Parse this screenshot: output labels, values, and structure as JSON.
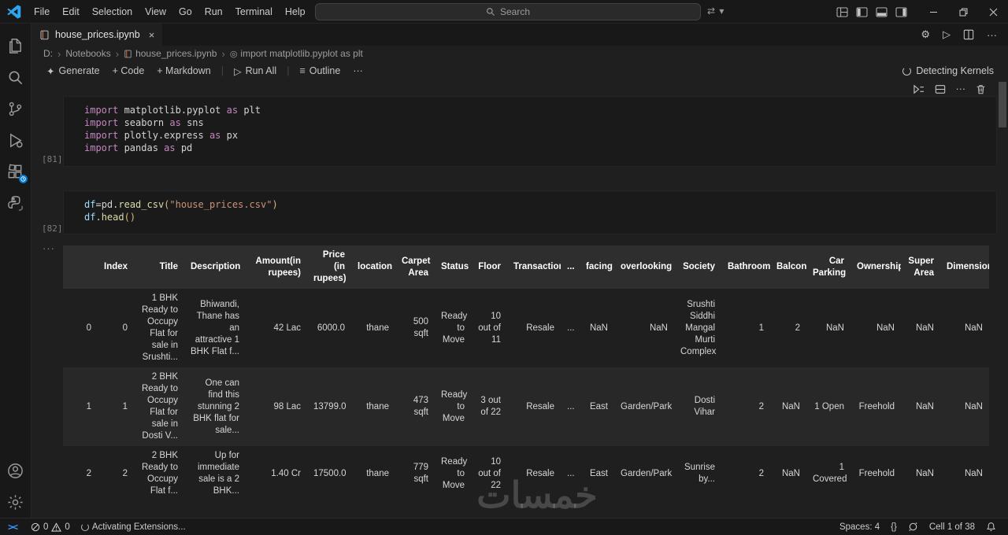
{
  "colors": {
    "accent": "#0078d4",
    "keyword": "#c586c0",
    "string": "#ce9178",
    "function": "#dcdcaa",
    "variable": "#9cdcfe",
    "editor_bg": "#1f1f1f",
    "chrome_bg": "#181818"
  },
  "title_bar": {
    "menus": [
      "File",
      "Edit",
      "Selection",
      "View",
      "Go",
      "Run",
      "Terminal",
      "Help"
    ],
    "search_placeholder": "Search"
  },
  "tab_bar": {
    "tab_label": "house_prices.ipynb",
    "close_glyph": "×"
  },
  "breadcrumb": {
    "items": [
      "D:",
      "Notebooks",
      "house_prices.ipynb",
      "import matplotlib.pyplot as plt"
    ]
  },
  "notebook_toolbar": {
    "generate": "Generate",
    "add_code": "+ Code",
    "add_markdown": "+ Markdown",
    "run_all": "Run All",
    "outline": "Outline",
    "more": "···",
    "kernel_status": "Detecting Kernels"
  },
  "cells": [
    {
      "exec": "[81]",
      "lines": [
        [
          {
            "t": "import",
            "c": "kw"
          },
          {
            "t": " matplotlib.pyplot ",
            "c": "id"
          },
          {
            "t": "as",
            "c": "kw"
          },
          {
            "t": " plt",
            "c": "id"
          }
        ],
        [
          {
            "t": "import",
            "c": "kw"
          },
          {
            "t": " seaborn ",
            "c": "id"
          },
          {
            "t": "as",
            "c": "kw"
          },
          {
            "t": " sns",
            "c": "id"
          }
        ],
        [
          {
            "t": "import",
            "c": "kw"
          },
          {
            "t": " plotly.express ",
            "c": "id"
          },
          {
            "t": "as",
            "c": "kw"
          },
          {
            "t": " px",
            "c": "id"
          }
        ],
        [
          {
            "t": "import",
            "c": "kw"
          },
          {
            "t": " pandas ",
            "c": "id"
          },
          {
            "t": "as",
            "c": "kw"
          },
          {
            "t": " pd",
            "c": "id"
          }
        ]
      ]
    },
    {
      "exec": "[82]",
      "lines": [
        [
          {
            "t": "df",
            "c": "var"
          },
          {
            "t": "=",
            "c": "pun"
          },
          {
            "t": "pd",
            "c": "id"
          },
          {
            "t": ".",
            "c": "pun"
          },
          {
            "t": "read_csv",
            "c": "fn"
          },
          {
            "t": "(",
            "c": "br"
          },
          {
            "t": "\"house_prices.csv\"",
            "c": "str"
          },
          {
            "t": ")",
            "c": "br"
          }
        ],
        [
          {
            "t": "df",
            "c": "var"
          },
          {
            "t": ".",
            "c": "pun"
          },
          {
            "t": "head",
            "c": "fn"
          },
          {
            "t": "(",
            "c": "br"
          },
          {
            "t": ")",
            "c": "br"
          }
        ]
      ]
    }
  ],
  "output_table": {
    "columns": [
      "",
      "Index",
      "Title",
      "Description",
      "Amount(in rupees)",
      "Price (in rupees)",
      "location",
      "Carpet Area",
      "Status",
      "Floor",
      "Transaction",
      "...",
      "facing",
      "overlooking",
      "Society",
      "Bathroom",
      "Balcony",
      "Car Parking",
      "Ownership",
      "Super Area",
      "Dimensions"
    ],
    "rows": [
      [
        "0",
        "0",
        "1 BHK Ready to Occupy Flat for sale in Srushti...",
        "Bhiwandi, Thane has an attractive 1 BHK Flat f...",
        "42 Lac",
        "6000.0",
        "thane",
        "500 sqft",
        "Ready to Move",
        "10 out of 11",
        "Resale",
        "...",
        "NaN",
        "NaN",
        "Srushti Siddhi Mangal Murti Complex",
        "1",
        "2",
        "NaN",
        "NaN",
        "NaN",
        "NaN"
      ],
      [
        "1",
        "1",
        "2 BHK Ready to Occupy Flat for sale in Dosti V...",
        "One can find this stunning 2 BHK flat for sale...",
        "98 Lac",
        "13799.0",
        "thane",
        "473 sqft",
        "Ready to Move",
        "3 out of 22",
        "Resale",
        "...",
        "East",
        "Garden/Park",
        "Dosti Vihar",
        "2",
        "NaN",
        "1 Open",
        "Freehold",
        "NaN",
        "NaN"
      ],
      [
        "2",
        "2",
        "2 BHK Ready to Occupy Flat f...",
        "Up for immediate sale is a 2 BHK...",
        "1.40 Cr",
        "17500.0",
        "thane",
        "779 sqft",
        "Ready to Move",
        "10 out of 22",
        "Resale",
        "...",
        "East",
        "Garden/Park",
        "Sunrise by...",
        "2",
        "NaN",
        "1 Covered",
        "Freehold",
        "NaN",
        "NaN"
      ]
    ]
  },
  "watermark": "خمسات",
  "status_bar": {
    "remote_glyph": "><",
    "errors": "0",
    "warnings": "0",
    "activating": "Activating Extensions...",
    "spaces": "Spaces: 4",
    "braces": "{}",
    "cell_indicator": "Cell 1 of 38"
  }
}
